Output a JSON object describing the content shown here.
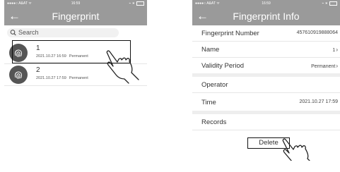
{
  "list_screen": {
    "status": {
      "left": "●●●●○ A&AT ᯤ",
      "time": "16:59",
      "right": "⌁ ∗"
    },
    "back_icon": "arrow-left-icon",
    "title": "Fingerprint",
    "search": {
      "placeholder": "Search",
      "icon": "search-icon"
    },
    "items": [
      {
        "name": "1",
        "datetime": "2021.10.27 16:59",
        "validity": "Permanent",
        "icon": "fingerprint-icon"
      },
      {
        "name": "2",
        "datetime": "2021.10.27 17:59",
        "validity": "Permanent",
        "icon": "fingerprint-icon"
      }
    ]
  },
  "info_screen": {
    "status": {
      "left": "●●●●○ A&AT ᯤ",
      "time": "16:59",
      "right": "⌁ ∗"
    },
    "back_icon": "arrow-left-icon",
    "title": "Fingerprint Info",
    "rows": [
      {
        "label": "Fingerprint Number",
        "value": "457610919888064"
      },
      {
        "label": "Name",
        "value": "1",
        "chevron": "›"
      },
      {
        "label": "Validity Period",
        "value": "Permanent",
        "chevron": "›"
      },
      {
        "label": "Operator",
        "value": ""
      },
      {
        "label": "Time",
        "value": "2021.10.27 17:59"
      },
      {
        "label": "Records",
        "value": ""
      }
    ],
    "delete_label": "Delete"
  },
  "colors": {
    "header": "#9a9a9a",
    "gap": "#eeeeee",
    "avatar": "#555555"
  }
}
